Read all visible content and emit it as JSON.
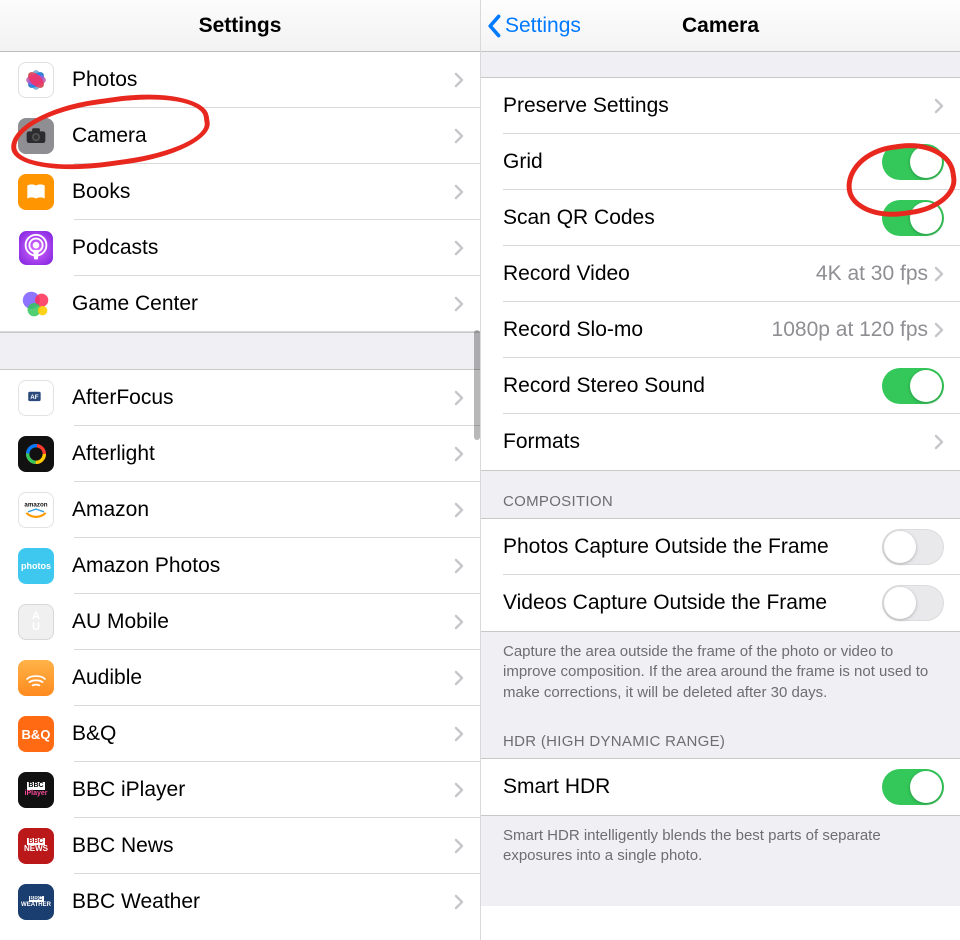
{
  "left": {
    "title": "Settings",
    "group1": [
      {
        "id": "photos",
        "label": "Photos",
        "icon": "photos-icon"
      },
      {
        "id": "camera",
        "label": "Camera",
        "icon": "camera-icon"
      },
      {
        "id": "books",
        "label": "Books",
        "icon": "books-icon"
      },
      {
        "id": "podcasts",
        "label": "Podcasts",
        "icon": "podcasts-icon"
      },
      {
        "id": "gamecenter",
        "label": "Game Center",
        "icon": "gamecenter-icon"
      }
    ],
    "group2": [
      {
        "id": "afterfocus",
        "label": "AfterFocus"
      },
      {
        "id": "afterlight",
        "label": "Afterlight"
      },
      {
        "id": "amazon",
        "label": "Amazon"
      },
      {
        "id": "amazonphotos",
        "label": "Amazon Photos"
      },
      {
        "id": "aumobile",
        "label": "AU Mobile"
      },
      {
        "id": "audible",
        "label": "Audible"
      },
      {
        "id": "bq",
        "label": "B&Q"
      },
      {
        "id": "bbciplayer",
        "label": "BBC iPlayer"
      },
      {
        "id": "bbcnews",
        "label": "BBC News"
      },
      {
        "id": "bbcweather",
        "label": "BBC Weather"
      }
    ]
  },
  "right": {
    "back": "Settings",
    "title": "Camera",
    "rows": {
      "preserve": "Preserve Settings",
      "grid": "Grid",
      "scanqr": "Scan QR Codes",
      "recvideo": "Record Video",
      "recvideo_val": "4K at 30 fps",
      "recslomo": "Record Slo-mo",
      "recslomo_val": "1080p at 120 fps",
      "stereo": "Record Stereo Sound",
      "formats": "Formats"
    },
    "toggles": {
      "grid": true,
      "scanqr": true,
      "stereo": true,
      "photosOutside": false,
      "videosOutside": false,
      "smarthdr": true
    },
    "composition": {
      "header": "COMPOSITION",
      "photosOutside": "Photos Capture Outside the Frame",
      "videosOutside": "Videos Capture Outside the Frame",
      "footer": "Capture the area outside the frame of the photo or video to improve composition. If the area around the frame is not used to make corrections, it will be deleted after 30 days."
    },
    "hdr": {
      "header": "HDR (HIGH DYNAMIC RANGE)",
      "smart": "Smart HDR",
      "footer": "Smart HDR intelligently blends the best parts of separate exposures into a single photo."
    }
  },
  "annotations": {
    "a1": "Camera row circled",
    "a2": "Grid toggle circled"
  }
}
